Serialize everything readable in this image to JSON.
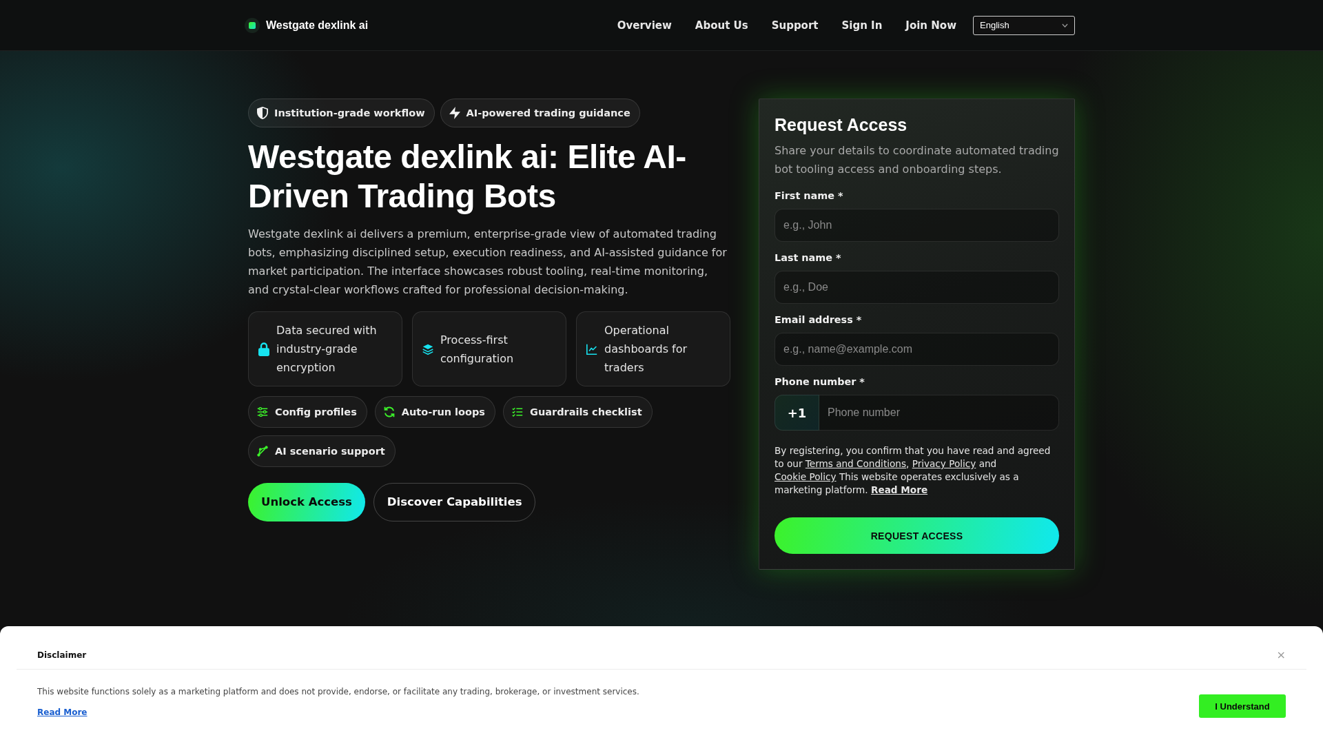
{
  "header": {
    "logo": "Westgate dexlink ai",
    "nav": [
      {
        "label": "Overview"
      },
      {
        "label": "About Us"
      },
      {
        "label": "Support"
      },
      {
        "label": "Sign In"
      },
      {
        "label": "Join Now"
      }
    ],
    "language": {
      "value": "English"
    }
  },
  "hero": {
    "badges": [
      "Institution-grade workflow",
      "AI-powered trading guidance"
    ],
    "title": "Westgate dexlink ai: Elite AI-Driven Trading Bots",
    "description": "Westgate dexlink ai delivers a premium, enterprise-grade view of automated trading bots, emphasizing disciplined setup, execution readiness, and AI-assisted guidance for market participation. The interface showcases robust tooling, real-time monitoring, and crystal-clear workflows crafted for professional decision-making.",
    "features": [
      "Data secured with industry-grade encryption",
      "Process-first configuration",
      "Operational dashboards for traders"
    ],
    "tags": [
      "Config profiles",
      "Auto-run loops",
      "Guardrails checklist",
      "AI scenario support"
    ],
    "actions": [
      {
        "kind": "primary",
        "label": "Unlock Access"
      },
      {
        "kind": "secondary",
        "label": "Discover Capabilities"
      }
    ]
  },
  "form": {
    "title": "Request Access",
    "description": "Share your details to coordinate automated trading bot tooling access and onboarding steps.",
    "fields": [
      {
        "kind": "text",
        "label": "First name *",
        "placeholder": "e.g., John"
      },
      {
        "kind": "text",
        "label": "Last name *",
        "placeholder": "e.g., Doe"
      },
      {
        "kind": "text",
        "label": "Email address *",
        "placeholder": "e.g., name@example.com"
      },
      {
        "kind": "phone",
        "label": "Phone number *",
        "prefix": "+1",
        "placeholder": "Phone number"
      }
    ],
    "consent": [
      {
        "kind": "text",
        "text": "By registering, you confirm that you have read and agreed to our "
      },
      {
        "kind": "link",
        "text": "Terms and Conditions"
      },
      {
        "kind": "text",
        "text": ", "
      },
      {
        "kind": "link",
        "text": "Privacy Policy"
      },
      {
        "kind": "text",
        "text": " and "
      },
      {
        "kind": "link",
        "text": "Cookie Policy"
      },
      {
        "kind": "text",
        "text": " This website operates exclusively as a marketing platform. "
      },
      {
        "kind": "strong_link",
        "text": "Read More"
      }
    ],
    "submit": "REQUEST ACCESS"
  },
  "disclaimer": {
    "title": "Disclaimer",
    "close": "×",
    "text": "This website functions solely as a marketing platform and does not provide, endorse, or facilitate any trading, brokerage, or investment services.",
    "link": "Read More",
    "button": "I Understand"
  }
}
